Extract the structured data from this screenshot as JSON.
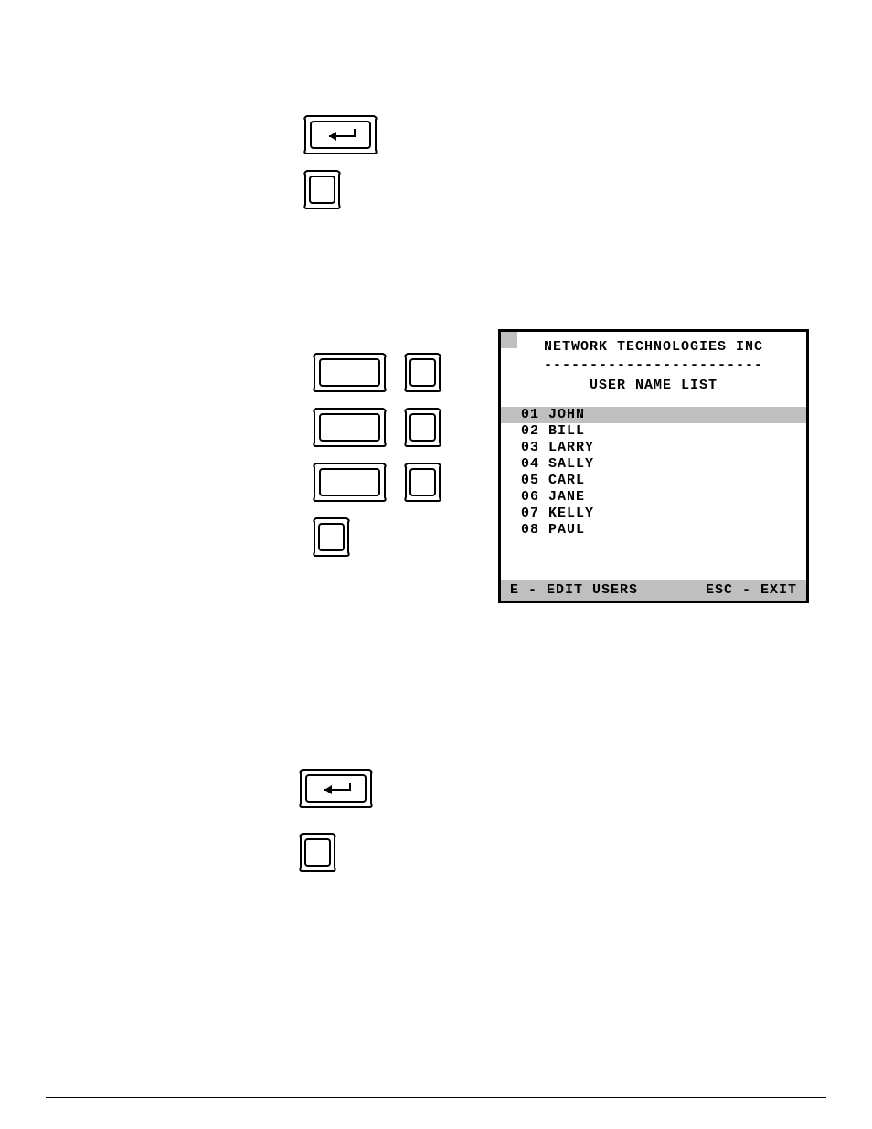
{
  "panel": {
    "title": "NETWORK TECHNOLOGIES INC",
    "dashes": "------------------------",
    "subtitle": "USER NAME LIST",
    "users": [
      {
        "num": "01",
        "name": "JOHN",
        "selected": true
      },
      {
        "num": "02",
        "name": "BILL",
        "selected": false
      },
      {
        "num": "03",
        "name": "LARRY",
        "selected": false
      },
      {
        "num": "04",
        "name": "SALLY",
        "selected": false
      },
      {
        "num": "05",
        "name": "CARL",
        "selected": false
      },
      {
        "num": "06",
        "name": "JANE",
        "selected": false
      },
      {
        "num": "07",
        "name": "KELLY",
        "selected": false
      },
      {
        "num": "08",
        "name": "PAUL",
        "selected": false
      }
    ],
    "footer_left": "E - EDIT USERS",
    "footer_right": "ESC - EXIT"
  },
  "keys": {
    "enter": "enter",
    "blank_small": "",
    "wide": "",
    "small": ""
  }
}
